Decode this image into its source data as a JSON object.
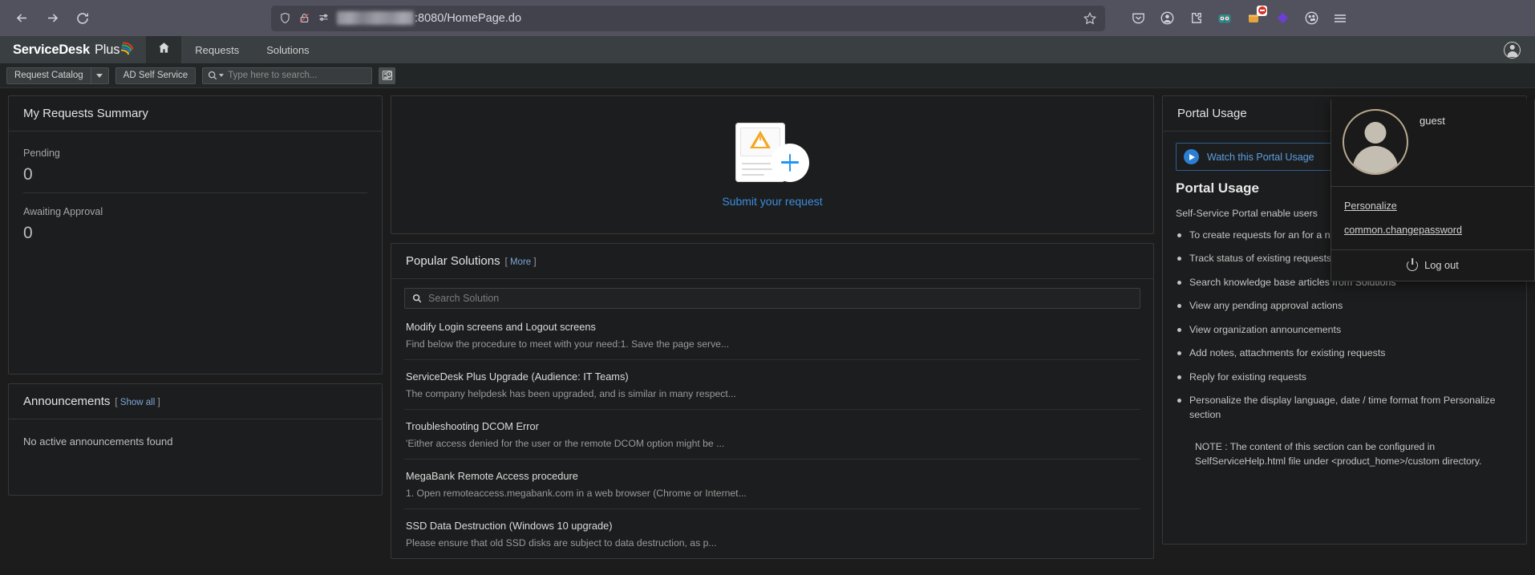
{
  "browser": {
    "back_icon": "back-arrow-icon",
    "forward_icon": "forward-arrow-icon",
    "reload_icon": "reload-icon",
    "shield_icon": "tracking-protection-shield-icon",
    "lock_icon": "insecure-connection-icon",
    "permissions_icon": "site-permissions-icon",
    "url_prefix_redacted": "",
    "url": ":8080/HomePage.do",
    "bookmark_icon": "star-bookmark-icon",
    "extensions": [
      {
        "name": "pocket-save-icon"
      },
      {
        "name": "account-circle-icon"
      },
      {
        "name": "extensions-puzzle-icon"
      },
      {
        "name": "bitwarden-extension-icon"
      },
      {
        "name": "adblock-extension-icon",
        "badge": "blocked"
      },
      {
        "name": "purple-diamond-extension-icon"
      },
      {
        "name": "cookie-extension-icon"
      },
      {
        "name": "app-menu-hamburger-icon"
      }
    ]
  },
  "app_header": {
    "brand_primary": "ServiceDesk",
    "brand_secondary": "Plus",
    "home_icon": "home-icon",
    "nav": [
      {
        "label": "Requests"
      },
      {
        "label": "Solutions"
      }
    ],
    "user_icon": "user-account-icon"
  },
  "sub_toolbar": {
    "request_catalog_label": "Request Catalog",
    "ad_self_service_label": "AD Self Service",
    "search_placeholder": "Type here to search...",
    "search_value": "",
    "search_icon": "search-magnifier-icon",
    "history_icon": "search-history-icon"
  },
  "user_menu": {
    "avatar_icon": "user-avatar-icon",
    "username": "guest",
    "items": [
      {
        "label": "Personalize"
      },
      {
        "label": "common.changepassword"
      }
    ],
    "logout_label": "Log out",
    "logout_icon": "power-icon"
  },
  "my_requests_summary": {
    "title": "My Requests Summary",
    "metrics": [
      {
        "label": "Pending",
        "value": "0"
      },
      {
        "label": "Awaiting Approval",
        "value": "0"
      }
    ]
  },
  "announcements": {
    "title": "Announcements",
    "show_all_label": "Show all",
    "empty_text": "No active announcements found"
  },
  "submit_request": {
    "label": "Submit your request",
    "icon": "new-request-document-icon",
    "plus_icon": "plus-circle-icon",
    "warning_icon": "warning-triangle-icon"
  },
  "popular_solutions": {
    "title": "Popular Solutions",
    "more_label": "More",
    "search_placeholder": "Search Solution",
    "search_value": "",
    "search_icon": "search-magnifier-icon",
    "items": [
      {
        "title": "Modify Login screens and Logout screens",
        "desc": "Find below the procedure to meet with your need:1. Save the page serve..."
      },
      {
        "title": "ServiceDesk Plus Upgrade (Audience: IT Teams)",
        "desc": "The company helpdesk has been upgraded, and is similar in many respect..."
      },
      {
        "title": "Troubleshooting DCOM Error",
        "desc": "'Either access denied for the user or the remote DCOM option might be ..."
      },
      {
        "title": "MegaBank Remote Access procedure",
        "desc": "1. Open remoteaccess.megabank.com in a web browser (Chrome or Internet..."
      },
      {
        "title": "SSD Data Destruction (Windows 10 upgrade)",
        "desc": "Please ensure that old SSD disks are subject to data destruction, as p..."
      }
    ]
  },
  "portal_usage": {
    "card_title": "Portal Usage",
    "watch_label": "Watch this Portal Usage",
    "play_icon": "play-circle-icon",
    "heading": "Portal Usage",
    "intro": "Self-Service Portal enable users",
    "bullets": [
      "To create requests for an\nfor a new resource or new service",
      "Track status of existing requests",
      "Search knowledge base articles from Solutions",
      "View any pending approval actions",
      "View organization announcements",
      "Add notes, attachments for existing requests",
      "Reply for existing requests",
      "Personalize the display language, date / time format from Personalize section"
    ],
    "note": "NOTE : The content of this section can be configured in SelfServiceHelp.html file under <product_home>/custom directory."
  },
  "colors": {
    "accent_blue": "#3c8dde",
    "warning_orange": "#f5a623",
    "page_bg": "#1c1c1c",
    "chrome_bg": "#52525e"
  }
}
